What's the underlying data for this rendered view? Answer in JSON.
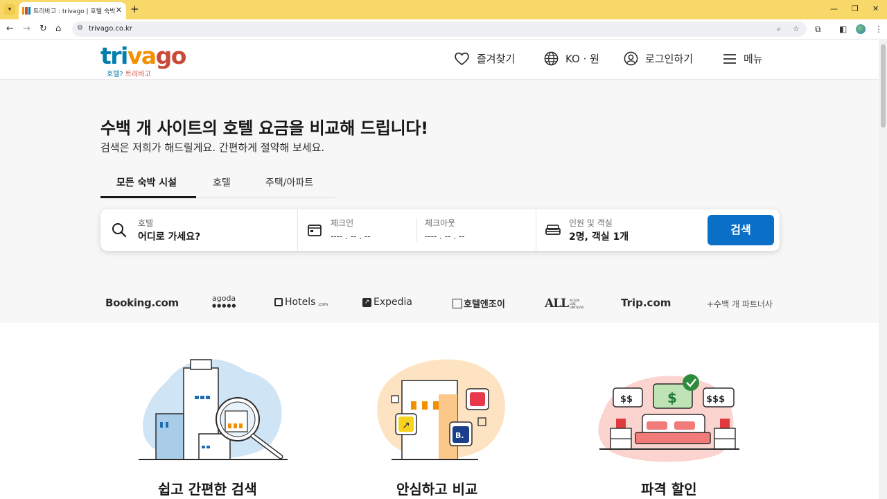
{
  "browser": {
    "tab_title": "트리바고 : trivago | 호텔 숙박",
    "url": "trivago.co.kr",
    "new_tab_glyph": "+",
    "close_glyph": "✕"
  },
  "brand": {
    "logo_part1": "tri",
    "logo_part2": "va",
    "logo_part3": "go",
    "tagline_part1": "호텔?",
    "tagline_part2": "트리바고",
    "colors": {
      "blue": "#007fad",
      "orange": "#f48f00",
      "red": "#c94a38"
    }
  },
  "header_nav": {
    "favorites": "즐겨찾기",
    "language_currency": "KO · 원",
    "login": "로그인하기",
    "menu": "메뉴"
  },
  "hero": {
    "title": "수백 개 사이트의 호텔 요금을 비교해 드립니다!",
    "subtitle": "검색은 저희가 해드릴게요. 간편하게 절약해 보세요."
  },
  "property_tabs": [
    {
      "label": "모든 숙박 시설",
      "active": true
    },
    {
      "label": "호텔",
      "active": false
    },
    {
      "label": "주택/아파트",
      "active": false
    }
  ],
  "search": {
    "destination_label": "호텔",
    "destination_placeholder": "어디로 가세요?",
    "checkin_label": "체크인",
    "checkin_value": "---- . -- . --",
    "checkout_label": "체크아웃",
    "checkout_value": "---- . -- . --",
    "guests_label": "인원 및 객실",
    "guests_value": "2명, 객실 1개",
    "button_label": "검색",
    "button_color": "#0a6fc6"
  },
  "partners": {
    "booking": "Booking.com",
    "agoda": "agoda",
    "hotels": "Hotels",
    "hotels_suffix": ".com",
    "expedia": "Expedia",
    "hotelnjoy": "호텔엔조이",
    "accor": "ALL",
    "accor_sub1": "ACCOR",
    "accor_sub2": "LIVE",
    "accor_sub3": "LIMITLESS",
    "trip": "Trip.com",
    "more": "+수백 개 파트너사"
  },
  "features": {
    "easy_search": "쉽고 간편한 검색",
    "trusted_compare": "안심하고 비교",
    "great_deals": "파격 할인",
    "price_low": "$$",
    "price_mid": "$",
    "price_high": "$$$",
    "booking_badge": "B."
  }
}
